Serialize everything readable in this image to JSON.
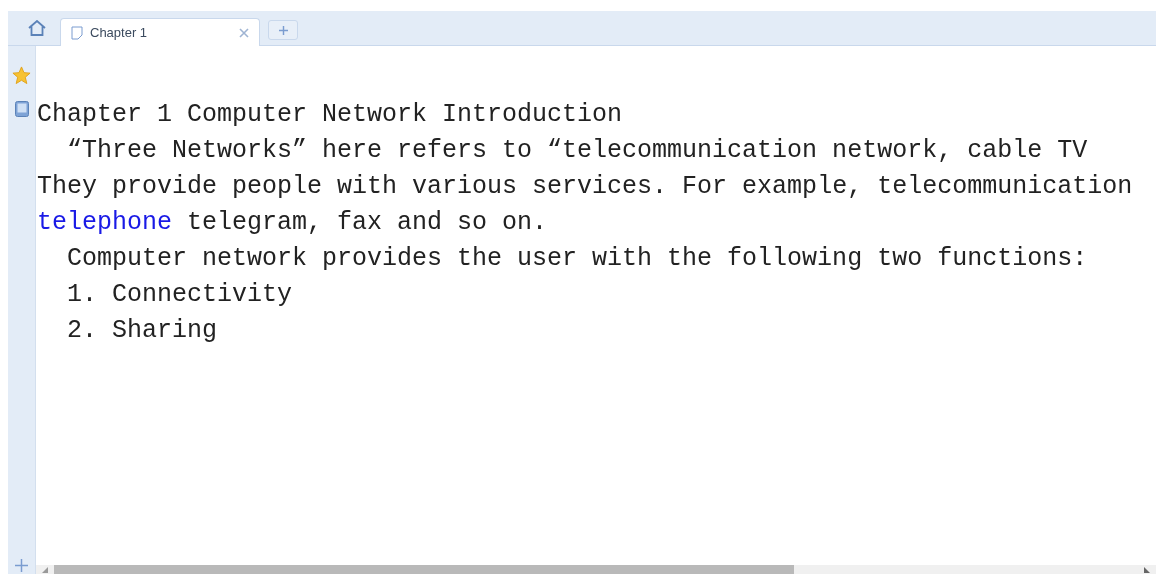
{
  "tabs": [
    {
      "label": "Chapter 1",
      "selected": true
    }
  ],
  "document": {
    "lines": [
      {
        "kind": "plain",
        "parts": [
          {
            "kind": "text",
            "text": "Chapter 1 Computer Network Introduction"
          }
        ]
      },
      {
        "kind": "indented",
        "parts": [
          {
            "kind": "text",
            "text": "“Three Networks” here refers to “telecommunication network, cable TV"
          }
        ]
      },
      {
        "kind": "plain",
        "parts": [
          {
            "kind": "text",
            "text": "They provide people with various services. For example, telecommunication"
          }
        ]
      },
      {
        "kind": "plain",
        "parts": [
          {
            "kind": "link",
            "text": "telephone"
          },
          {
            "kind": "text",
            "text": " telegram, fax and so on."
          }
        ]
      },
      {
        "kind": "indented",
        "parts": [
          {
            "kind": "text",
            "text": "Computer network provides the user with the following two functions:"
          }
        ]
      },
      {
        "kind": "indented",
        "parts": [
          {
            "kind": "text",
            "text": "1. Connectivity"
          }
        ]
      },
      {
        "kind": "indented",
        "parts": [
          {
            "kind": "text",
            "text": "2. Sharing"
          }
        ]
      }
    ]
  }
}
